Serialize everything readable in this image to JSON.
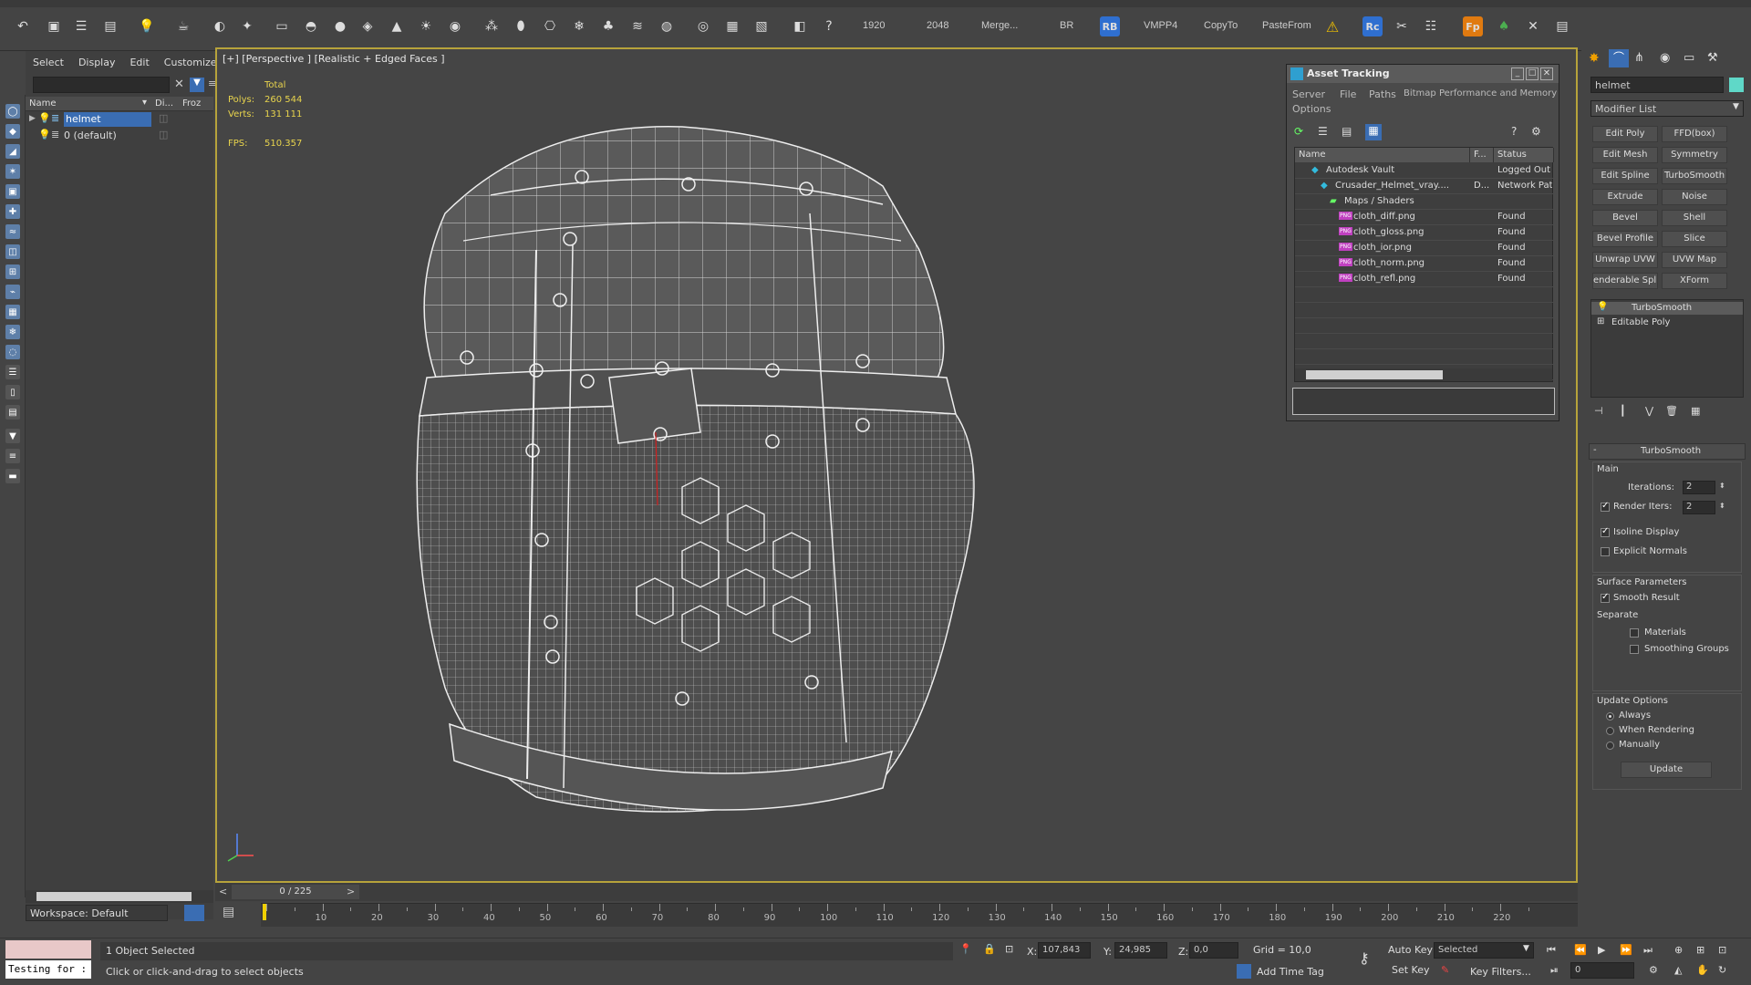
{
  "toolbar": {
    "texts": [
      "1920",
      "2048",
      "Merge...",
      "BR",
      "VMPP4",
      "CopyTo",
      "PasteFrom"
    ],
    "rb_badge": "RB",
    "rc_badge": "Rc",
    "fp_badge": "Fp"
  },
  "scene_explorer": {
    "menu": [
      "Select",
      "Display",
      "Edit",
      "Customize"
    ],
    "columns": [
      "Name",
      "Di...",
      "Froz"
    ],
    "rows": [
      {
        "name": "helmet",
        "selected": true
      },
      {
        "name": "0 (default)",
        "selected": false
      }
    ],
    "workspace": "Workspace: Default"
  },
  "viewport": {
    "label": "[+] [Perspective ] [Realistic + Edged Faces ]",
    "stats": {
      "total_label": "Total",
      "polys_label": "Polys:",
      "polys_value": "260 544",
      "verts_label": "Verts:",
      "verts_value": "131 111",
      "fps_label": "FPS:",
      "fps_value": "510.357"
    }
  },
  "asset_tracking": {
    "title": "Asset Tracking",
    "menu": [
      "Server",
      "File",
      "Paths",
      "Bitmap Performance and Memory",
      "Options"
    ],
    "columns": [
      "Name",
      "F...",
      "Status"
    ],
    "rows": [
      {
        "name": "Autodesk Vault",
        "f": "",
        "status": "Logged Out",
        "indent": 1
      },
      {
        "name": "Crusader_Helmet_vray....",
        "f": "D...",
        "status": "Network Pat",
        "indent": 2
      },
      {
        "name": "Maps / Shaders",
        "f": "",
        "status": "",
        "indent": 3
      },
      {
        "name": "cloth_diff.png",
        "f": "",
        "status": "Found",
        "indent": 4
      },
      {
        "name": "cloth_gloss.png",
        "f": "",
        "status": "Found",
        "indent": 4
      },
      {
        "name": "cloth_ior.png",
        "f": "",
        "status": "Found",
        "indent": 4
      },
      {
        "name": "cloth_norm.png",
        "f": "",
        "status": "Found",
        "indent": 4
      },
      {
        "name": "cloth_refl.png",
        "f": "",
        "status": "Found",
        "indent": 4
      }
    ],
    "png_tag": "PNG"
  },
  "command_panel": {
    "object_name": "helmet",
    "modifier_list": "Modifier List",
    "modifier_buttons": [
      "Edit Poly",
      "FFD(box)",
      "Edit Mesh",
      "Symmetry",
      "Edit Spline",
      "TurboSmooth",
      "Extrude",
      "Noise",
      "Bevel",
      "Shell",
      "Bevel Profile",
      "Slice",
      "Unwrap UVW",
      "UVW Map",
      "enderable Splin",
      "XForm"
    ],
    "stack": [
      "TurboSmooth",
      "Editable Poly"
    ],
    "rollout_title": "TurboSmooth",
    "main_label": "Main",
    "iterations_label": "Iterations:",
    "iterations_value": "2",
    "render_iters_label": "Render Iters:",
    "render_iters_value": "2",
    "isoline_label": "Isoline Display",
    "explicit_label": "Explicit Normals",
    "surface_label": "Surface Parameters",
    "smooth_label": "Smooth Result",
    "separate_label": "Separate",
    "materials_label": "Materials",
    "smoothing_label": "Smoothing Groups",
    "update_options_label": "Update Options",
    "always_label": "Always",
    "when_rendering_label": "When Rendering",
    "manually_label": "Manually",
    "update_button": "Update"
  },
  "timeline": {
    "frame": "0 / 225",
    "ticks": [
      "10",
      "20",
      "30",
      "40",
      "50",
      "60",
      "70",
      "80",
      "90",
      "100",
      "110",
      "120",
      "130",
      "140",
      "150",
      "160",
      "170",
      "180",
      "190",
      "200",
      "210",
      "220"
    ]
  },
  "status_bar": {
    "script_text": "Testing for :",
    "selection": "1 Object Selected",
    "prompt": "Click or click-and-drag to select objects",
    "x_label": "X:",
    "x_value": "107,843",
    "y_label": "Y:",
    "y_value": "24,985",
    "z_label": "Z:",
    "z_value": "0,0",
    "grid": "Grid = 10,0",
    "add_time_tag": "Add Time Tag",
    "auto_key": "Auto Key",
    "set_key": "Set Key",
    "selected_dropdown": "Selected",
    "key_filters": "Key Filters...",
    "frame_value": "0"
  }
}
